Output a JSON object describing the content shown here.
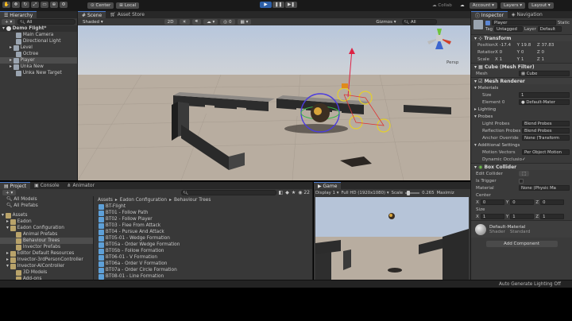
{
  "toolbar": {
    "account": "Account",
    "layers": "Layers",
    "layout": "Layout",
    "collab": "Collab",
    "center": "Center",
    "local": "Local"
  },
  "hierarchy": {
    "tab": "Hierarchy",
    "search_btn": "All",
    "scene": "Demo Flight*",
    "items": [
      "Main Camera",
      "Directional Light",
      "Level",
      "Octree",
      "Player",
      "Unka New",
      "Unka New Target"
    ]
  },
  "scene": {
    "tab_scene": "Scene",
    "tab_store": "Asset Store",
    "shading": "Shaded",
    "mode2d": "2D",
    "gizmos": "Gizmos",
    "search": "All",
    "persp": "Persp"
  },
  "inspector": {
    "tab": "Inspector",
    "tab_nav": "Navigation",
    "name": "Player",
    "static": "Static",
    "tag_label": "Tag",
    "tag": "Untagged",
    "layer_label": "Layer",
    "layer": "Default",
    "transform": {
      "title": "Transform",
      "rows": [
        {
          "label": "Position",
          "x": "-17.4",
          "y": "19.8",
          "z": "37.83"
        },
        {
          "label": "Rotation",
          "x": "0",
          "y": "0",
          "z": "0"
        },
        {
          "label": "Scale",
          "x": "1",
          "y": "1",
          "z": "1"
        }
      ]
    },
    "mesh_filter": {
      "title": "Cube (Mesh Filter)",
      "mesh_label": "Mesh",
      "mesh": "Cube"
    },
    "mesh_renderer": {
      "title": "Mesh Renderer",
      "materials": "Materials",
      "size_label": "Size",
      "size": "1",
      "element_label": "Element 0",
      "element": "Default-Mater",
      "lighting": "Lighting",
      "probes": "Probes",
      "light_label": "Light Probes",
      "light": "Blend Probes",
      "reflect_label": "Reflection Probes",
      "reflect": "Blend Probes",
      "anchor_label": "Anchor Override",
      "anchor": "None (Transform",
      "additional": "Additional Settings",
      "motion_label": "Motion Vectors",
      "motion": "Per Object Motion",
      "occlusion_label": "Dynamic Occlusio"
    },
    "box_collider": {
      "title": "Box Collider",
      "edit_label": "Edit Collider",
      "trigger_label": "Is Trigger",
      "material_label": "Material",
      "material": "None (Physic Ma",
      "center_label": "Center",
      "center": {
        "x": "0",
        "y": "0",
        "z": "0"
      },
      "size_label": "Size",
      "size": {
        "x": "1",
        "y": "1",
        "z": "1"
      }
    },
    "material": {
      "name": "Default-Material",
      "shader_label": "Shader",
      "shader": "Standard"
    },
    "add_component": "Add Component"
  },
  "project": {
    "tab_project": "Project",
    "tab_console": "Console",
    "tab_animator": "Animator",
    "favorites": [
      "All Models",
      "All Prefabs"
    ],
    "tree": [
      "Assets",
      "Eadon",
      "Eadon Configuration",
      "Animal Prefabs",
      "Behaviour Trees",
      "Invector Prefabs",
      "Editor Default Resources",
      "Invector-3rdPersonController",
      "Invector-AIController",
      "3D Models",
      "Add-ons"
    ],
    "breadcrumb": [
      "Assets",
      "Eadon Configuration",
      "Behaviour Trees"
    ],
    "count": "22",
    "files": [
      "BT-Flight",
      "BT01 - Follow Path",
      "BT02 - Follow Player",
      "BT03 - Flee From Attack",
      "BT04 - Pursue And Attack",
      "BT05-01 - Wedge Formation",
      "BT05a - Order Wedge Formation",
      "BT05b - Follow Formation",
      "BT06-01 - V Formation",
      "BT06a - Order V Formation",
      "BT07a - Order Circle Formation",
      "BT08-01 - Line Formation"
    ]
  },
  "game": {
    "tab": "Game",
    "display": "Display 1",
    "resolution": "Full HD (1920x1080)",
    "scale_label": "Scale",
    "scale": "0.265",
    "maximize": "Maximiz"
  },
  "status": {
    "text": "Auto Generate Lighting Off"
  },
  "colors": {
    "accent": "#4a7acd",
    "panel": "#383838",
    "dark": "#282828"
  }
}
